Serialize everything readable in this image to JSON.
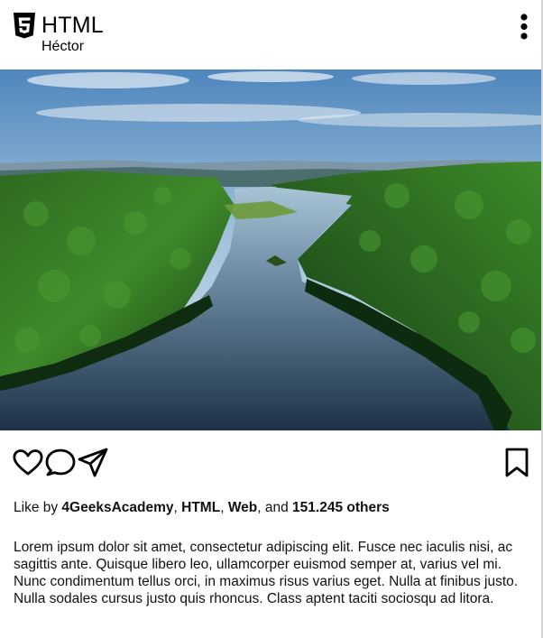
{
  "header": {
    "icon": "html5-icon",
    "title": "HTML",
    "subtitle": "Héctor",
    "menu_icon": "more-vertical-icon"
  },
  "photo": {
    "description_icon": "landscape-image"
  },
  "actions": {
    "like_icon": "heart-icon",
    "comment_icon": "comment-icon",
    "share_icon": "paper-plane-icon",
    "save_icon": "bookmark-icon"
  },
  "likes": {
    "prefix": "Like by ",
    "users": [
      "4GeeksAcademy",
      "HTML",
      "Web"
    ],
    "sep1": ", ",
    "sep2": ", ",
    "and": ", and ",
    "others": "151.245 others"
  },
  "caption": {
    "text": "Lorem ipsum dolor sit amet, consectetur adipiscing elit. Fusce nec iaculis nisi, ac sagittis ante. Quisque libero leo, ullamcorper euismod semper at, varius vel mi. Nunc condimentum tellus orci, in maximus risus varius eget. Nulla at finibus justo. Nulla sodales cursus justo quis rhoncus. Class aptent taciti sociosqu ad litora."
  },
  "colors": {
    "text": "#111111",
    "icon": "#000000"
  }
}
